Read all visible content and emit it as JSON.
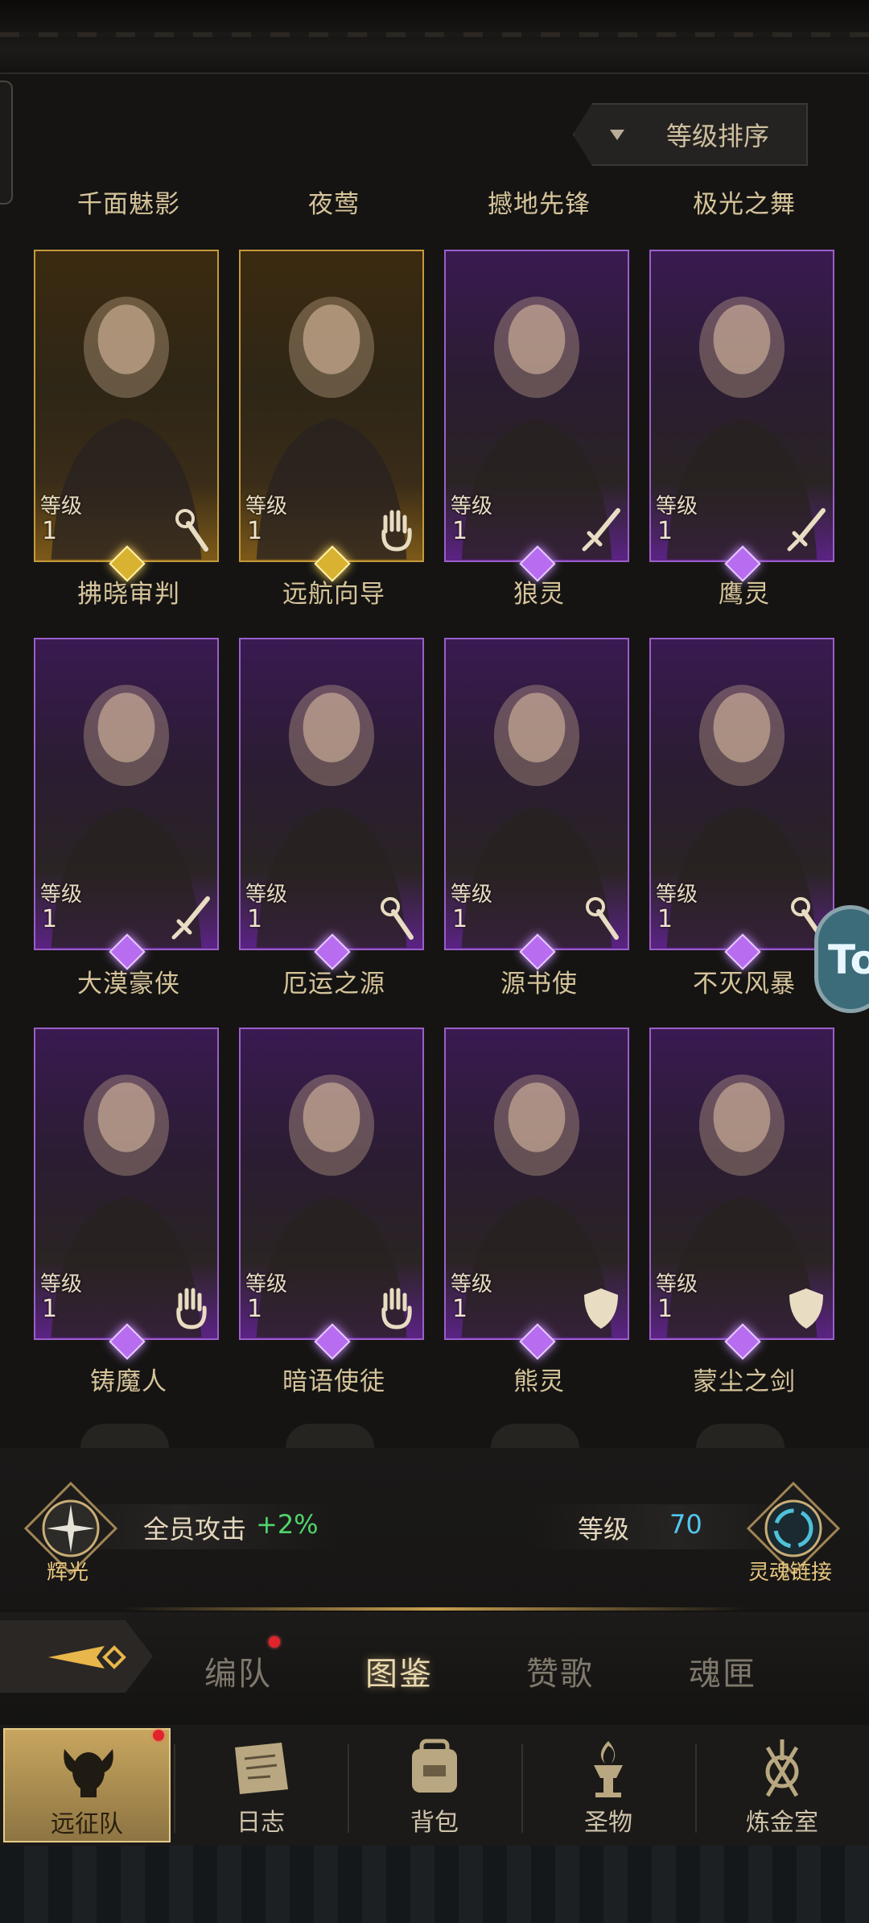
{
  "header": {
    "sort_label": "等级排序"
  },
  "level_label": "等级",
  "heroes": [
    {
      "name": "千面魅影",
      "level": "1",
      "rarity": "gold",
      "class_icon": "staff-icon"
    },
    {
      "name": "夜莺",
      "level": "1",
      "rarity": "gold",
      "class_icon": "palm-icon"
    },
    {
      "name": "撼地先锋",
      "level": "1",
      "rarity": "purple",
      "class_icon": "sword-icon"
    },
    {
      "name": "极光之舞",
      "level": "1",
      "rarity": "purple",
      "class_icon": "sword-icon"
    },
    {
      "name": "拂晓审判",
      "level": "1",
      "rarity": "purple",
      "class_icon": "sword-icon"
    },
    {
      "name": "远航向导",
      "level": "1",
      "rarity": "purple",
      "class_icon": "staff-icon"
    },
    {
      "name": "狼灵",
      "level": "1",
      "rarity": "purple",
      "class_icon": "staff-icon"
    },
    {
      "name": "鹰灵",
      "level": "1",
      "rarity": "purple",
      "class_icon": "staff-icon"
    },
    {
      "name": "大漠豪侠",
      "level": "1",
      "rarity": "purple",
      "class_icon": "palm-icon"
    },
    {
      "name": "厄运之源",
      "level": "1",
      "rarity": "purple",
      "class_icon": "palm-icon"
    },
    {
      "name": "源书使",
      "level": "1",
      "rarity": "purple",
      "class_icon": "shield-icon"
    },
    {
      "name": "不灭风暴",
      "level": "1",
      "rarity": "purple",
      "class_icon": "shield-icon"
    }
  ],
  "bottom_names": [
    "铸魔人",
    "暗语使徒",
    "熊灵",
    "蒙尘之剑"
  ],
  "stats": {
    "attack_label": "全员攻击",
    "attack_value": "+2%",
    "level_label": "等级",
    "level_value": "70",
    "glory_label": "辉光",
    "soul_link_label": "灵魂链接"
  },
  "tabs": [
    {
      "label": "编队",
      "active": false,
      "badge": true
    },
    {
      "label": "图鉴",
      "active": true,
      "badge": false
    },
    {
      "label": "赞歌",
      "active": false,
      "badge": false
    },
    {
      "label": "魂匣",
      "active": false,
      "badge": false
    }
  ],
  "nav": [
    {
      "label": "远征队",
      "icon": "horned-skull-icon",
      "active": true,
      "badge": true
    },
    {
      "label": "日志",
      "icon": "map-scroll-icon",
      "active": false,
      "badge": false
    },
    {
      "label": "背包",
      "icon": "bag-icon",
      "active": false,
      "badge": false
    },
    {
      "label": "圣物",
      "icon": "torch-icon",
      "active": false,
      "badge": false
    },
    {
      "label": "炼金室",
      "icon": "alchemy-icon",
      "active": false,
      "badge": false
    }
  ],
  "floating_button": {
    "text": "To"
  },
  "colors": {
    "purple_frame": "#9b5fc9",
    "gold_frame": "#c59a3b",
    "attack_green": "#4fd66a",
    "level_blue": "#52c8f0"
  }
}
